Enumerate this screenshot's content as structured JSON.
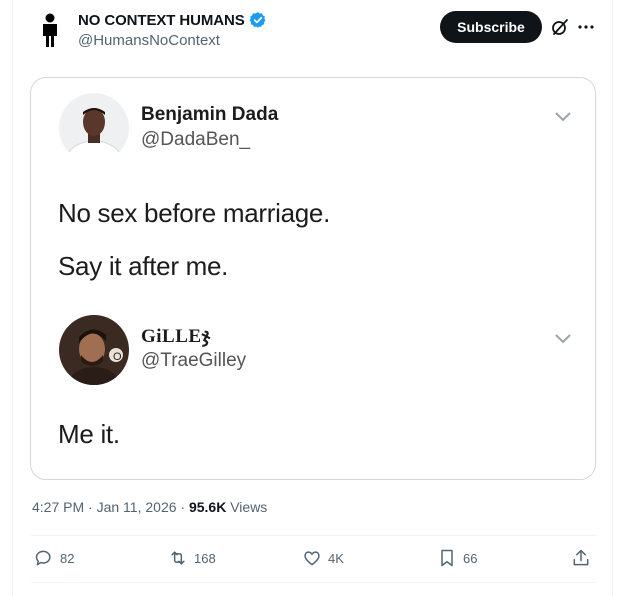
{
  "author": {
    "name": "NO CONTEXT HUMANS",
    "handle": "@HumansNoContext",
    "verified_color": "#1d9bf0"
  },
  "header": {
    "subscribe_label": "Subscribe",
    "grok_icon": "grok-icon",
    "more_icon": "more-icon"
  },
  "embedded": {
    "post1": {
      "name": "Benjamin Dada",
      "handle": "@DadaBen_",
      "line1": "No sex before marriage.",
      "line2": "Say it after me."
    },
    "post2": {
      "name": "GiLLEჯ",
      "handle": "@TraeGilley",
      "line1": "Me it."
    }
  },
  "meta": {
    "time": "4:27 PM",
    "date": "Jan 11, 2026",
    "views_count": "95.6K",
    "views_label": "Views"
  },
  "actions": {
    "replies": "82",
    "reposts": "168",
    "likes": "4K",
    "bookmarks": "66"
  },
  "colors": {
    "primary_text": "#0f1419",
    "secondary_text": "#536471",
    "border": "#cfd9de"
  }
}
